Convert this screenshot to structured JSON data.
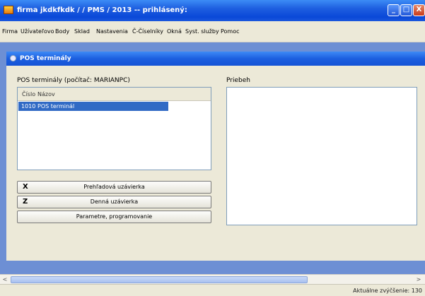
{
  "window": {
    "title": "firma jkdkfkdk / / PMS / 2013 -- prihlásený:",
    "minimize_glyph": "_",
    "maximize_glyph": "□",
    "close_glyph": "X"
  },
  "menu": {
    "items": [
      "Firma",
      "Užívateľovo",
      "Body",
      "Sklad",
      "Nastavenia",
      "Č-Číselníky",
      "Okná",
      "Syst. služby",
      "Pomoc"
    ]
  },
  "child_window": {
    "title": "POS terminály"
  },
  "pos_panel": {
    "label": "POS terminály (počítač: MARIANPC)",
    "columns": [
      "Číslo",
      "Názov"
    ],
    "rows": [
      {
        "cislo": "1010",
        "nazov": "POS terminál"
      }
    ]
  },
  "actions": [
    {
      "key": "X",
      "label": "Prehľadová uzávierka"
    },
    {
      "key": "Z",
      "label": "Denná uzávierka"
    },
    {
      "key": "",
      "label": "Parametre, programovanie"
    }
  ],
  "log_panel": {
    "label": "Priebeh"
  },
  "scrollbar": {
    "left_arrow": "<",
    "right_arrow": ">"
  },
  "status": {
    "text": "Aktuálne zvýčšenie: 130"
  },
  "colors": {
    "title_blue": "#0a48d8",
    "selection": "#316ac5",
    "workspace": "#6d8fd4"
  }
}
